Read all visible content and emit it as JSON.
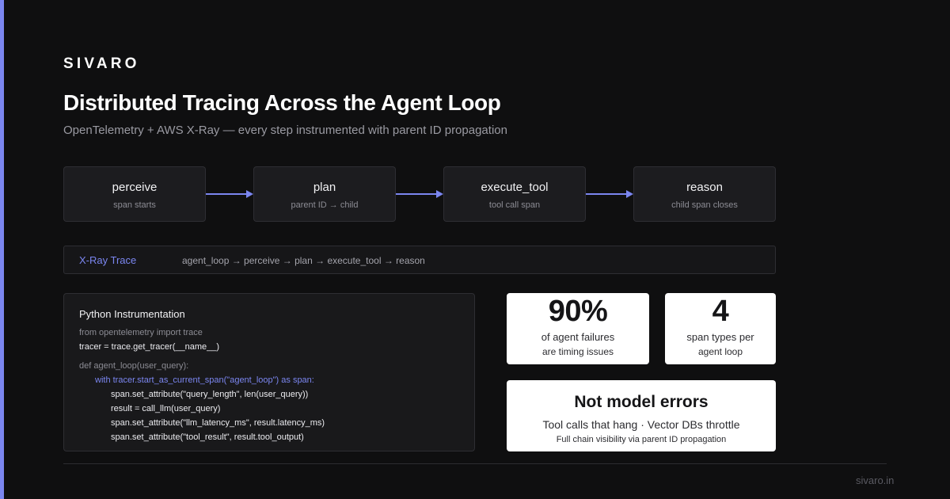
{
  "brand": "SIVARO",
  "title": "Distributed Tracing Across the Agent Loop",
  "subtitle": "OpenTelemetry + AWS X-Ray — every step instrumented with parent ID propagation",
  "flow": [
    {
      "name": "perceive",
      "desc": "span starts"
    },
    {
      "name": "plan",
      "desc": "parent ID → child"
    },
    {
      "name": "execute_tool",
      "desc": "tool call span"
    },
    {
      "name": "reason",
      "desc": "child span closes"
    }
  ],
  "trace": {
    "label": "X-Ray Trace",
    "path": "agent_loop → perceive → plan → execute_tool → reason"
  },
  "code": {
    "title": "Python Instrumentation",
    "lines": [
      "from opentelemetry import trace",
      "tracer = trace.get_tracer(__name__)",
      "def agent_loop(user_query):",
      "with tracer.start_as_current_span(\"agent_loop\") as span:",
      "span.set_attribute(\"query_length\", len(user_query))",
      "result = call_llm(user_query)",
      "span.set_attribute(\"llm_latency_ms\", result.latency_ms)",
      "span.set_attribute(\"tool_result\", result.tool_output)"
    ]
  },
  "stats": [
    {
      "value": "90%",
      "line1": "of agent failures",
      "line2": "are timing issues"
    },
    {
      "value": "4",
      "line1": "span types per",
      "line2": "agent loop"
    }
  ],
  "callout": {
    "title": "Not model errors",
    "line1": "Tool calls that hang · Vector DBs throttle",
    "line2": "Full chain visibility via parent ID propagation"
  },
  "footer": "sivaro.in",
  "colors": {
    "accent": "#7b86f0",
    "background": "#0f0f10",
    "card": "#ffffff"
  }
}
